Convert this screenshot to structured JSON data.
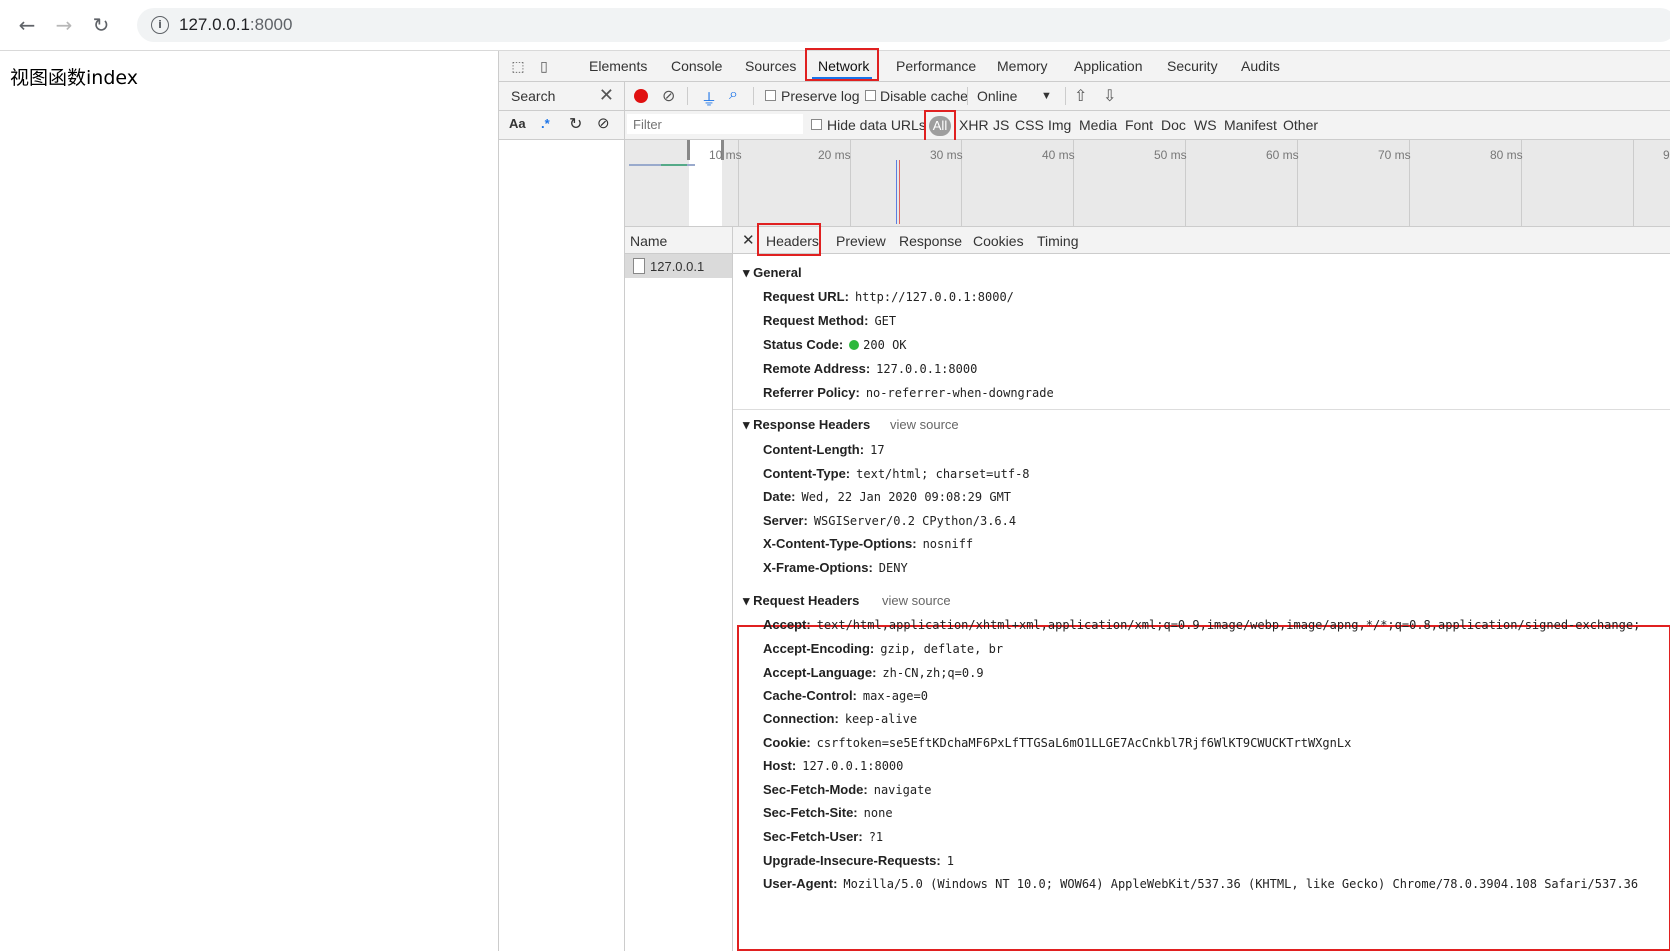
{
  "browser": {
    "url_host": "127.0.0.1",
    "url_port": ":8000"
  },
  "page": {
    "text": "视图函数index"
  },
  "devtools": {
    "tabs": [
      "Elements",
      "Console",
      "Sources",
      "Network",
      "Performance",
      "Memory",
      "Application",
      "Security",
      "Audits"
    ],
    "active_tab": "Network",
    "search": {
      "title": "Search",
      "case_label": "Aa",
      "regex_label": ".*"
    },
    "toolbar": {
      "preserve_log": "Preserve log",
      "disable_cache": "Disable cache",
      "throttle": "Online"
    },
    "filter": {
      "placeholder": "Filter",
      "hide_data_urls": "Hide data URLs",
      "types": [
        "All",
        "XHR",
        "JS",
        "CSS",
        "Img",
        "Media",
        "Font",
        "Doc",
        "WS",
        "Manifest",
        "Other"
      ]
    },
    "timeline": {
      "ticks": [
        "10 ms",
        "20 ms",
        "30 ms",
        "40 ms",
        "50 ms",
        "60 ms",
        "70 ms",
        "80 ms",
        "9"
      ]
    },
    "requests": {
      "header": "Name",
      "rows": [
        "127.0.0.1"
      ]
    },
    "detail_tabs": [
      "Headers",
      "Preview",
      "Response",
      "Cookies",
      "Timing"
    ],
    "general": {
      "title": "General",
      "items": [
        {
          "k": "Request URL:",
          "v": "http://127.0.0.1:8000/"
        },
        {
          "k": "Request Method:",
          "v": "GET"
        },
        {
          "k": "Status Code:",
          "v": "200 OK"
        },
        {
          "k": "Remote Address:",
          "v": "127.0.0.1:8000"
        },
        {
          "k": "Referrer Policy:",
          "v": "no-referrer-when-downgrade"
        }
      ]
    },
    "response_headers": {
      "title": "Response Headers",
      "view_source": "view source",
      "items": [
        {
          "k": "Content-Length:",
          "v": "17"
        },
        {
          "k": "Content-Type:",
          "v": "text/html; charset=utf-8"
        },
        {
          "k": "Date:",
          "v": "Wed, 22 Jan 2020 09:08:29 GMT"
        },
        {
          "k": "Server:",
          "v": "WSGIServer/0.2 CPython/3.6.4"
        },
        {
          "k": "X-Content-Type-Options:",
          "v": "nosniff"
        },
        {
          "k": "X-Frame-Options:",
          "v": "DENY"
        }
      ]
    },
    "request_headers": {
      "title": "Request Headers",
      "view_source": "view source",
      "items": [
        {
          "k": "Accept:",
          "v": "text/html,application/xhtml+xml,application/xml;q=0.9,image/webp,image/apng,*/*;q=0.8,application/signed-exchange;"
        },
        {
          "k": "Accept-Encoding:",
          "v": "gzip, deflate, br"
        },
        {
          "k": "Accept-Language:",
          "v": "zh-CN,zh;q=0.9"
        },
        {
          "k": "Cache-Control:",
          "v": "max-age=0"
        },
        {
          "k": "Connection:",
          "v": "keep-alive"
        },
        {
          "k": "Cookie:",
          "v": "csrftoken=se5EftKDchaMF6PxLfTTGSaL6mO1LLGE7AcCnkbl7Rjf6WlKT9CWUCKTrtWXgnLx"
        },
        {
          "k": "Host:",
          "v": "127.0.0.1:8000"
        },
        {
          "k": "Sec-Fetch-Mode:",
          "v": "navigate"
        },
        {
          "k": "Sec-Fetch-Site:",
          "v": "none"
        },
        {
          "k": "Sec-Fetch-User:",
          "v": "?1"
        },
        {
          "k": "Upgrade-Insecure-Requests:",
          "v": "1"
        },
        {
          "k": "User-Agent:",
          "v": "Mozilla/5.0 (Windows NT 10.0; WOW64) AppleWebKit/537.36 (KHTML, like Gecko) Chrome/78.0.3904.108 Safari/537.36"
        }
      ]
    }
  },
  "colors": {
    "highlight": "#e02020",
    "record": "#e01010",
    "status_ok": "#2db83d"
  }
}
